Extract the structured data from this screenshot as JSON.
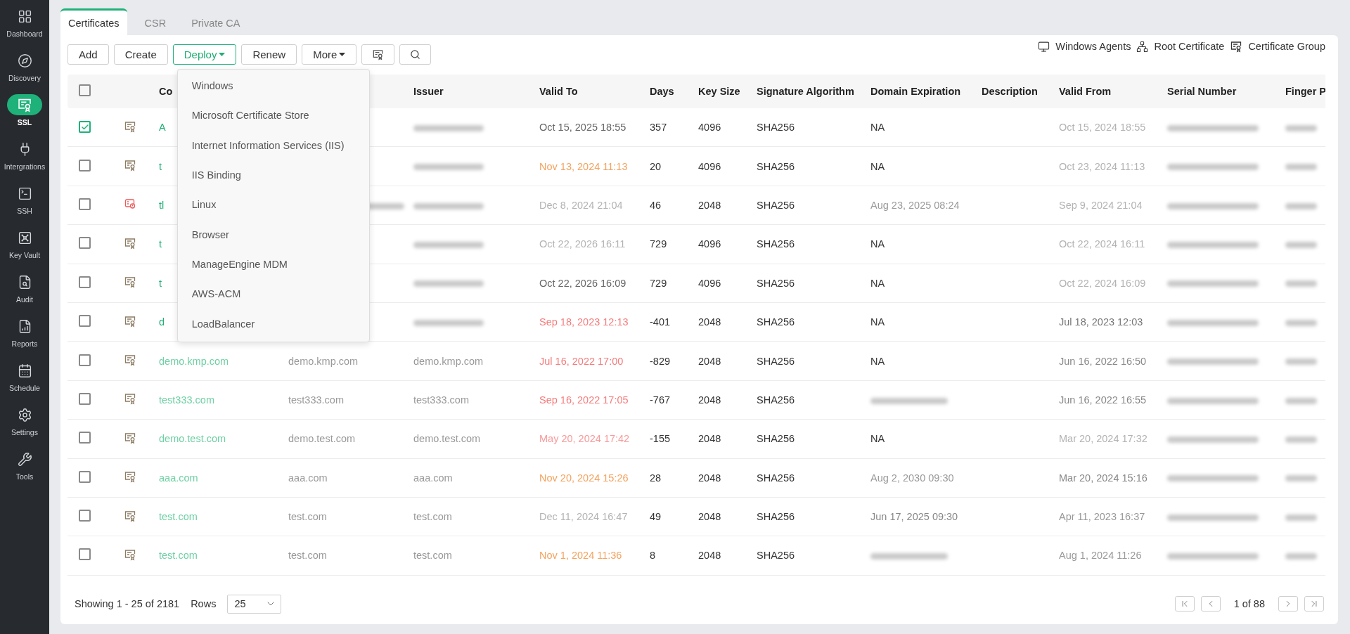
{
  "sidebar": {
    "items": [
      {
        "label": "Dashboard",
        "selected": false
      },
      {
        "label": "Discovery",
        "selected": false
      },
      {
        "label": "SSL",
        "selected": true
      },
      {
        "label": "Intergrations",
        "selected": false
      },
      {
        "label": "SSH",
        "selected": false
      },
      {
        "label": "Key Vault",
        "selected": false
      },
      {
        "label": "Audit",
        "selected": false
      },
      {
        "label": "Reports",
        "selected": false
      },
      {
        "label": "Schedule",
        "selected": false
      },
      {
        "label": "Settings",
        "selected": false
      },
      {
        "label": "Tools",
        "selected": false
      }
    ]
  },
  "tabs": [
    {
      "label": "Certificates",
      "selected": true
    },
    {
      "label": "CSR",
      "selected": false
    },
    {
      "label": "Private CA",
      "selected": false
    }
  ],
  "toolbar": {
    "buttons": [
      {
        "kind": "text",
        "label": "Add"
      },
      {
        "kind": "text",
        "label": "Create"
      },
      {
        "kind": "dropdown",
        "label": "Deploy",
        "expanded": true
      },
      {
        "kind": "text",
        "label": "Renew"
      },
      {
        "kind": "dropdown",
        "label": "More",
        "expanded": false
      },
      {
        "kind": "columns"
      },
      {
        "kind": "search"
      }
    ],
    "links": [
      "Windows Agents",
      "Root Certificate",
      "Certificate Group"
    ]
  },
  "deploy_menu": {
    "items": [
      "Windows",
      "Microsoft Certificate Store",
      "Internet Information Services (IIS)",
      "IIS Binding",
      "Linux",
      "Browser",
      "ManageEngine MDM",
      "AWS-ACM",
      "LoadBalancer"
    ]
  },
  "table": {
    "header_checkbox": {
      "checked": false
    },
    "columns": [
      {
        "label": "Co"
      },
      {},
      {
        "label": "Issuer"
      },
      {
        "label": "Valid To"
      },
      {
        "label": "Days"
      },
      {
        "label": "Key Size"
      },
      {
        "label": "Signature Algorithm"
      },
      {
        "label": "Domain Expiration"
      },
      {
        "label": "Description"
      },
      {
        "label": "Valid From"
      },
      {
        "label": "Serial Number"
      },
      {
        "label": "Finger P"
      }
    ],
    "rows": [
      {
        "checked": true,
        "warning": false,
        "cells": [
          {
            "text": "A"
          },
          null,
          {
            "kind": "blurred"
          },
          {
            "text": "Oct 15, 2025 18:55",
            "color": "#666666"
          },
          {
            "text": "357"
          },
          {
            "text": "4096"
          },
          {
            "text": "SHA256"
          },
          {
            "text": "NA"
          },
          null,
          {
            "text": "Oct 15, 2024 18:55",
            "color": "#b3b3b3"
          },
          {
            "kind": "blurred"
          },
          {
            "kind": "blurred"
          }
        ]
      },
      {
        "checked": false,
        "warning": false,
        "cells": [
          {
            "text": "t"
          },
          null,
          {
            "kind": "blurred"
          },
          {
            "text": "Nov 13, 2024 11:13",
            "color": "#f5a25d"
          },
          {
            "text": "20"
          },
          {
            "text": "4096"
          },
          {
            "text": "SHA256"
          },
          {
            "text": "NA"
          },
          null,
          {
            "text": "Oct 23, 2024 11:13",
            "color": "#b3b3b3"
          },
          {
            "kind": "blurred"
          },
          {
            "kind": "blurred"
          }
        ]
      },
      {
        "checked": false,
        "warning": true,
        "cells": [
          {
            "text": "tl"
          },
          {
            "kind": "blurred"
          },
          {
            "kind": "blurred"
          },
          {
            "text": "Dec 8, 2024 21:04",
            "color": "#b3b3b3"
          },
          {
            "text": "46"
          },
          {
            "text": "2048"
          },
          {
            "text": "SHA256"
          },
          {
            "text": "Aug 23, 2025 08:24",
            "color": "#9a9a9a"
          },
          null,
          {
            "text": "Sep 9, 2024 21:04",
            "color": "#b3b3b3"
          },
          {
            "kind": "blurred"
          },
          {
            "kind": "blurred"
          }
        ]
      },
      {
        "checked": false,
        "warning": false,
        "cells": [
          {
            "text": "t"
          },
          null,
          {
            "kind": "blurred"
          },
          {
            "text": "Oct 22, 2026 16:11",
            "color": "#b3b3b3"
          },
          {
            "text": "729"
          },
          {
            "text": "4096"
          },
          {
            "text": "SHA256"
          },
          {
            "text": "NA"
          },
          null,
          {
            "text": "Oct 22, 2024 16:11",
            "color": "#b3b3b3"
          },
          {
            "kind": "blurred"
          },
          {
            "kind": "blurred"
          }
        ]
      },
      {
        "checked": false,
        "warning": false,
        "cells": [
          {
            "text": "t"
          },
          null,
          {
            "kind": "blurred"
          },
          {
            "text": "Oct 22, 2026 16:09",
            "color": "#666666"
          },
          {
            "text": "729"
          },
          {
            "text": "4096"
          },
          {
            "text": "SHA256"
          },
          {
            "text": "NA"
          },
          null,
          {
            "text": "Oct 22, 2024 16:09",
            "color": "#b3b3b3"
          },
          {
            "kind": "blurred"
          },
          {
            "kind": "blurred"
          }
        ]
      },
      {
        "checked": false,
        "warning": false,
        "cells": [
          {
            "text": "d"
          },
          null,
          {
            "kind": "blurred"
          },
          {
            "text": "Sep 18, 2023 12:13",
            "color": "#f47c7c"
          },
          {
            "text": "-401"
          },
          {
            "text": "2048"
          },
          {
            "text": "SHA256"
          },
          {
            "text": "NA"
          },
          null,
          {
            "text": "Jul 18, 2023 12:03",
            "color": "#777777"
          },
          {
            "kind": "blurred"
          },
          {
            "kind": "blurred"
          }
        ]
      },
      {
        "checked": false,
        "warning": false,
        "cells": [
          {
            "text": "demo.kmp.com",
            "color": "#6fd0a5"
          },
          {
            "text": "demo.kmp.com",
            "color": "#999999"
          },
          {
            "text": "demo.kmp.com",
            "color": "#999999"
          },
          {
            "text": "Jul 16, 2022 17:00",
            "color": "#f47c7c"
          },
          {
            "text": "-829"
          },
          {
            "text": "2048"
          },
          {
            "text": "SHA256"
          },
          {
            "text": "NA"
          },
          null,
          {
            "text": "Jun 16, 2022 16:50",
            "color": "#888888"
          },
          {
            "kind": "blurred"
          },
          {
            "kind": "blurred"
          }
        ]
      },
      {
        "checked": false,
        "warning": false,
        "cells": [
          {
            "text": "test333.com",
            "color": "#6fd0a5"
          },
          {
            "text": "test333.com",
            "color": "#999999"
          },
          {
            "text": "test333.com",
            "color": "#999999"
          },
          {
            "text": "Sep 16, 2022 17:05",
            "color": "#f47c7c"
          },
          {
            "text": "-767"
          },
          {
            "text": "2048"
          },
          {
            "text": "SHA256"
          },
          {
            "kind": "blurred"
          },
          null,
          {
            "text": "Jun 16, 2022 16:55",
            "color": "#888888"
          },
          {
            "kind": "blurred"
          },
          {
            "kind": "blurred"
          }
        ]
      },
      {
        "checked": false,
        "warning": false,
        "cells": [
          {
            "text": "demo.test.com",
            "color": "#6fd0a5"
          },
          {
            "text": "demo.test.com",
            "color": "#999999"
          },
          {
            "text": "demo.test.com",
            "color": "#999999"
          },
          {
            "text": "May 20, 2024 17:42",
            "color": "#f79a9a"
          },
          {
            "text": "-155"
          },
          {
            "text": "2048"
          },
          {
            "text": "SHA256"
          },
          {
            "text": "NA"
          },
          null,
          {
            "text": "Mar 20, 2024 17:32",
            "color": "#b3b3b3"
          },
          {
            "kind": "blurred"
          },
          {
            "kind": "blurred"
          }
        ]
      },
      {
        "checked": false,
        "warning": false,
        "cells": [
          {
            "text": "aaa.com",
            "color": "#6fd0a5"
          },
          {
            "text": "aaa.com",
            "color": "#999999"
          },
          {
            "text": "aaa.com",
            "color": "#999999"
          },
          {
            "text": "Nov 20, 2024 15:26",
            "color": "#f5a25d"
          },
          {
            "text": "28"
          },
          {
            "text": "2048"
          },
          {
            "text": "SHA256"
          },
          {
            "text": "Aug 2, 2030 09:30",
            "color": "#999999"
          },
          null,
          {
            "text": "Mar 20, 2024 15:16",
            "color": "#888888"
          },
          {
            "kind": "blurred"
          },
          {
            "kind": "blurred"
          }
        ]
      },
      {
        "checked": false,
        "warning": false,
        "cells": [
          {
            "text": "test.com",
            "color": "#6fd0a5"
          },
          {
            "text": "test.com",
            "color": "#999999"
          },
          {
            "text": "test.com",
            "color": "#999999"
          },
          {
            "text": "Dec 11, 2024 16:47",
            "color": "#b3b3b3"
          },
          {
            "text": "49"
          },
          {
            "text": "2048"
          },
          {
            "text": "SHA256"
          },
          {
            "text": "Jun 17, 2025 09:30",
            "color": "#888888"
          },
          null,
          {
            "text": "Apr 11, 2023 16:37",
            "color": "#999999"
          },
          {
            "kind": "blurred"
          },
          {
            "kind": "blurred"
          }
        ]
      },
      {
        "checked": false,
        "warning": false,
        "cells": [
          {
            "text": "test.com",
            "color": "#6fd0a5"
          },
          {
            "text": "test.com",
            "color": "#999999"
          },
          {
            "text": "test.com",
            "color": "#999999"
          },
          {
            "text": "Nov 1, 2024 11:36",
            "color": "#f5a25d"
          },
          {
            "text": "8"
          },
          {
            "text": "2048"
          },
          {
            "text": "SHA256"
          },
          {
            "kind": "blurred"
          },
          null,
          {
            "text": "Aug 1, 2024 11:26",
            "color": "#999999"
          },
          {
            "kind": "blurred"
          },
          {
            "kind": "blurred"
          }
        ]
      }
    ]
  },
  "footer": {
    "summary": "Showing 1 - 25 of 2181",
    "rows_label": "Rows",
    "rows_value": "25",
    "page": "1 of 88"
  }
}
